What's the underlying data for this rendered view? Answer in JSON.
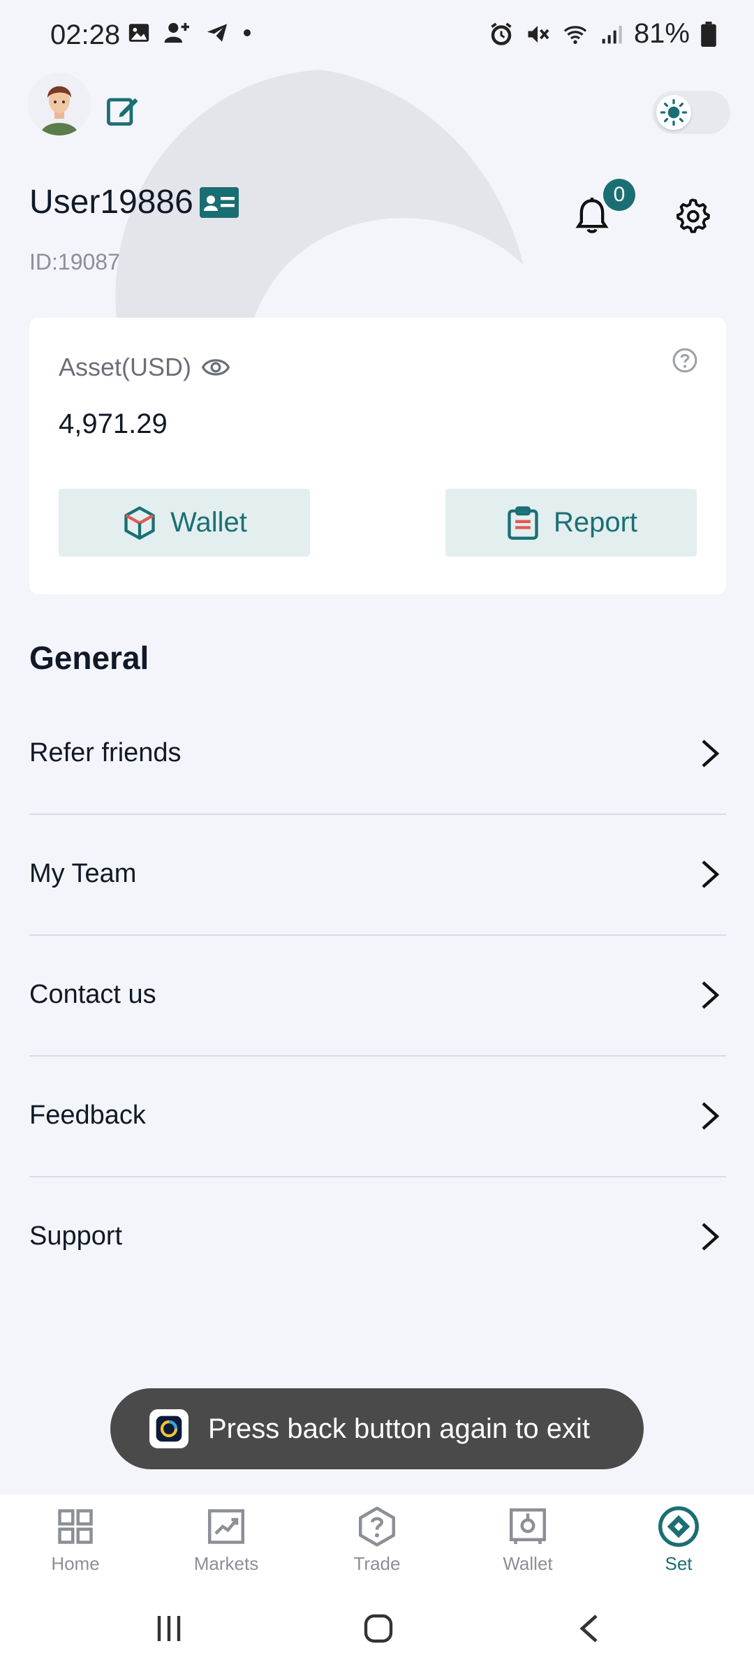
{
  "status_bar": {
    "time": "02:28",
    "battery": "81%"
  },
  "header": {
    "username": "User19886",
    "user_id": "ID:19087",
    "notification_count": "0"
  },
  "asset": {
    "label": "Asset(USD)",
    "value": "4,971.29",
    "wallet_label": "Wallet",
    "report_label": "Report"
  },
  "general": {
    "title": "General",
    "items": [
      {
        "label": "Refer friends"
      },
      {
        "label": "My Team"
      },
      {
        "label": "Contact us"
      },
      {
        "label": "Feedback"
      },
      {
        "label": "Support"
      }
    ]
  },
  "toast": {
    "text": "Press back button again to exit"
  },
  "bottom_nav": {
    "items": [
      {
        "label": "Home",
        "icon": "grid-icon"
      },
      {
        "label": "Markets",
        "icon": "chart-icon"
      },
      {
        "label": "Trade",
        "icon": "question-hex-icon"
      },
      {
        "label": "Wallet",
        "icon": "safe-icon"
      },
      {
        "label": "Set",
        "icon": "diamond-circle-icon",
        "active": true
      }
    ]
  },
  "colors": {
    "accent": "#1b6f74",
    "background": "#f4f5fa",
    "card": "#ffffff",
    "button_bg": "#e3eeef",
    "toast_bg": "#4a4a4a"
  }
}
